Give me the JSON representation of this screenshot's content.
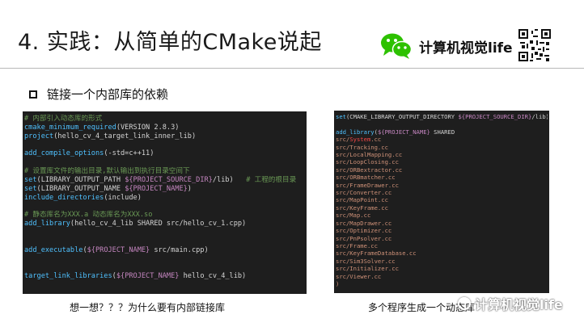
{
  "slide": {
    "title": "4. 实践：从简单的CMake说起",
    "brand_name": "计算机视觉life",
    "bullet": "链接一个内部库的依赖",
    "caption_left": "想一想？？？为什么要有内部链接库",
    "caption_right": "多个程序生成一个动态库",
    "watermark": "计算机视觉life"
  },
  "code_left": [
    [
      [
        "cm",
        "# 内部引入动态库的形式"
      ]
    ],
    [
      [
        "kw",
        "cmake_minimum_required"
      ],
      [
        "plain",
        "(VERSION 2.8.3)"
      ]
    ],
    [
      [
        "kw",
        "project"
      ],
      [
        "plain",
        "(hello_cv_4_target_link_inner_lib)"
      ]
    ],
    [
      [
        "plain",
        ""
      ]
    ],
    [
      [
        "kw",
        "add_compile_options"
      ],
      [
        "plain",
        "(-std=c++11)"
      ]
    ],
    [
      [
        "plain",
        ""
      ]
    ],
    [
      [
        "cm",
        "# 设置库文件的输出目录,默认输出到执行目录空间下"
      ]
    ],
    [
      [
        "kw",
        "set"
      ],
      [
        "plain",
        "(LIBRARY_OUTPUT_PATH "
      ],
      [
        "var",
        "${PROJECT_SOURCE_DIR}"
      ],
      [
        "plain",
        "/lib)   "
      ],
      [
        "cm",
        "# 工程的根目录"
      ]
    ],
    [
      [
        "kw",
        "set"
      ],
      [
        "plain",
        "(LIBRARY_OUTPUT_NAME "
      ],
      [
        "var",
        "${PROJECT_NAME}"
      ],
      [
        "plain",
        ")"
      ]
    ],
    [
      [
        "kw",
        "include_directories"
      ],
      [
        "plain",
        "(include)"
      ]
    ],
    [
      [
        "plain",
        ""
      ]
    ],
    [
      [
        "cm",
        "# 静态库名为XXX.a 动态库名为XXX.so"
      ]
    ],
    [
      [
        "kw",
        "add_library"
      ],
      [
        "plain",
        "(hello_cv_4_lib SHARED src/hello_cv_1.cpp)"
      ]
    ],
    [
      [
        "plain",
        ""
      ]
    ],
    [
      [
        "plain",
        ""
      ]
    ],
    [
      [
        "kw",
        "add_executable"
      ],
      [
        "plain",
        "("
      ],
      [
        "var",
        "${PROJECT_NAME}"
      ],
      [
        "plain",
        " src/main.cpp)"
      ]
    ],
    [
      [
        "plain",
        ""
      ]
    ],
    [
      [
        "plain",
        ""
      ]
    ],
    [
      [
        "kw",
        "target_link_libraries"
      ],
      [
        "plain",
        "("
      ],
      [
        "var",
        "${PROJECT_NAME}"
      ],
      [
        "plain",
        " hello_cv_4_lib)"
      ]
    ]
  ],
  "code_right": [
    [
      [
        "kw",
        "set"
      ],
      [
        "plain",
        "(CMAKE_LIBRARY_OUTPUT_DIRECTORY "
      ],
      [
        "var",
        "${PROJECT_SOURCE_DIR}"
      ],
      [
        "plain",
        "/lib)"
      ]
    ],
    [
      [
        "plain",
        ""
      ]
    ],
    [
      [
        "kw",
        "add_library"
      ],
      [
        "plain",
        "("
      ],
      [
        "var",
        "${PROJECT_NAME}"
      ],
      [
        "plain",
        " SHARED"
      ]
    ],
    [
      [
        "src",
        "src/"
      ],
      [
        "red",
        "System"
      ],
      [
        "src",
        ".cc"
      ]
    ],
    [
      [
        "src",
        "src/Tracking.cc"
      ]
    ],
    [
      [
        "src",
        "src/LocalMapping.cc"
      ]
    ],
    [
      [
        "src",
        "src/LoopClosing.cc"
      ]
    ],
    [
      [
        "src",
        "src/ORBextractor.cc"
      ]
    ],
    [
      [
        "src",
        "src/ORBmatcher.cc"
      ]
    ],
    [
      [
        "src",
        "src/FrameDrawer.cc"
      ]
    ],
    [
      [
        "src",
        "src/Converter.cc"
      ]
    ],
    [
      [
        "src",
        "src/MapPoint.cc"
      ]
    ],
    [
      [
        "src",
        "src/KeyFrame.cc"
      ]
    ],
    [
      [
        "src",
        "src/Map.cc"
      ]
    ],
    [
      [
        "src",
        "src/MapDrawer.cc"
      ]
    ],
    [
      [
        "src",
        "src/Optimizer.cc"
      ]
    ],
    [
      [
        "src",
        "src/PnPsolver.cc"
      ]
    ],
    [
      [
        "src",
        "src/Frame.cc"
      ]
    ],
    [
      [
        "src",
        "src/KeyFrameDatabase.cc"
      ]
    ],
    [
      [
        "src",
        "src/Sim3Solver.cc"
      ]
    ],
    [
      [
        "src",
        "src/Initializer.cc"
      ]
    ],
    [
      [
        "src",
        "src/Viewer.cc"
      ]
    ],
    [
      [
        "src",
        ")"
      ]
    ]
  ],
  "colors": {
    "code_bg": "#1e1e1e",
    "keyword": "#4fc1ff",
    "variable": "#c586c0",
    "comment": "#6a9955",
    "source": "#ce9178",
    "wechat_green": "#2dc100"
  },
  "icons": {
    "brand_logo": "wechat-icon",
    "qr": "qr-code-icon",
    "bullet": "hollow-square-bullet-icon"
  }
}
